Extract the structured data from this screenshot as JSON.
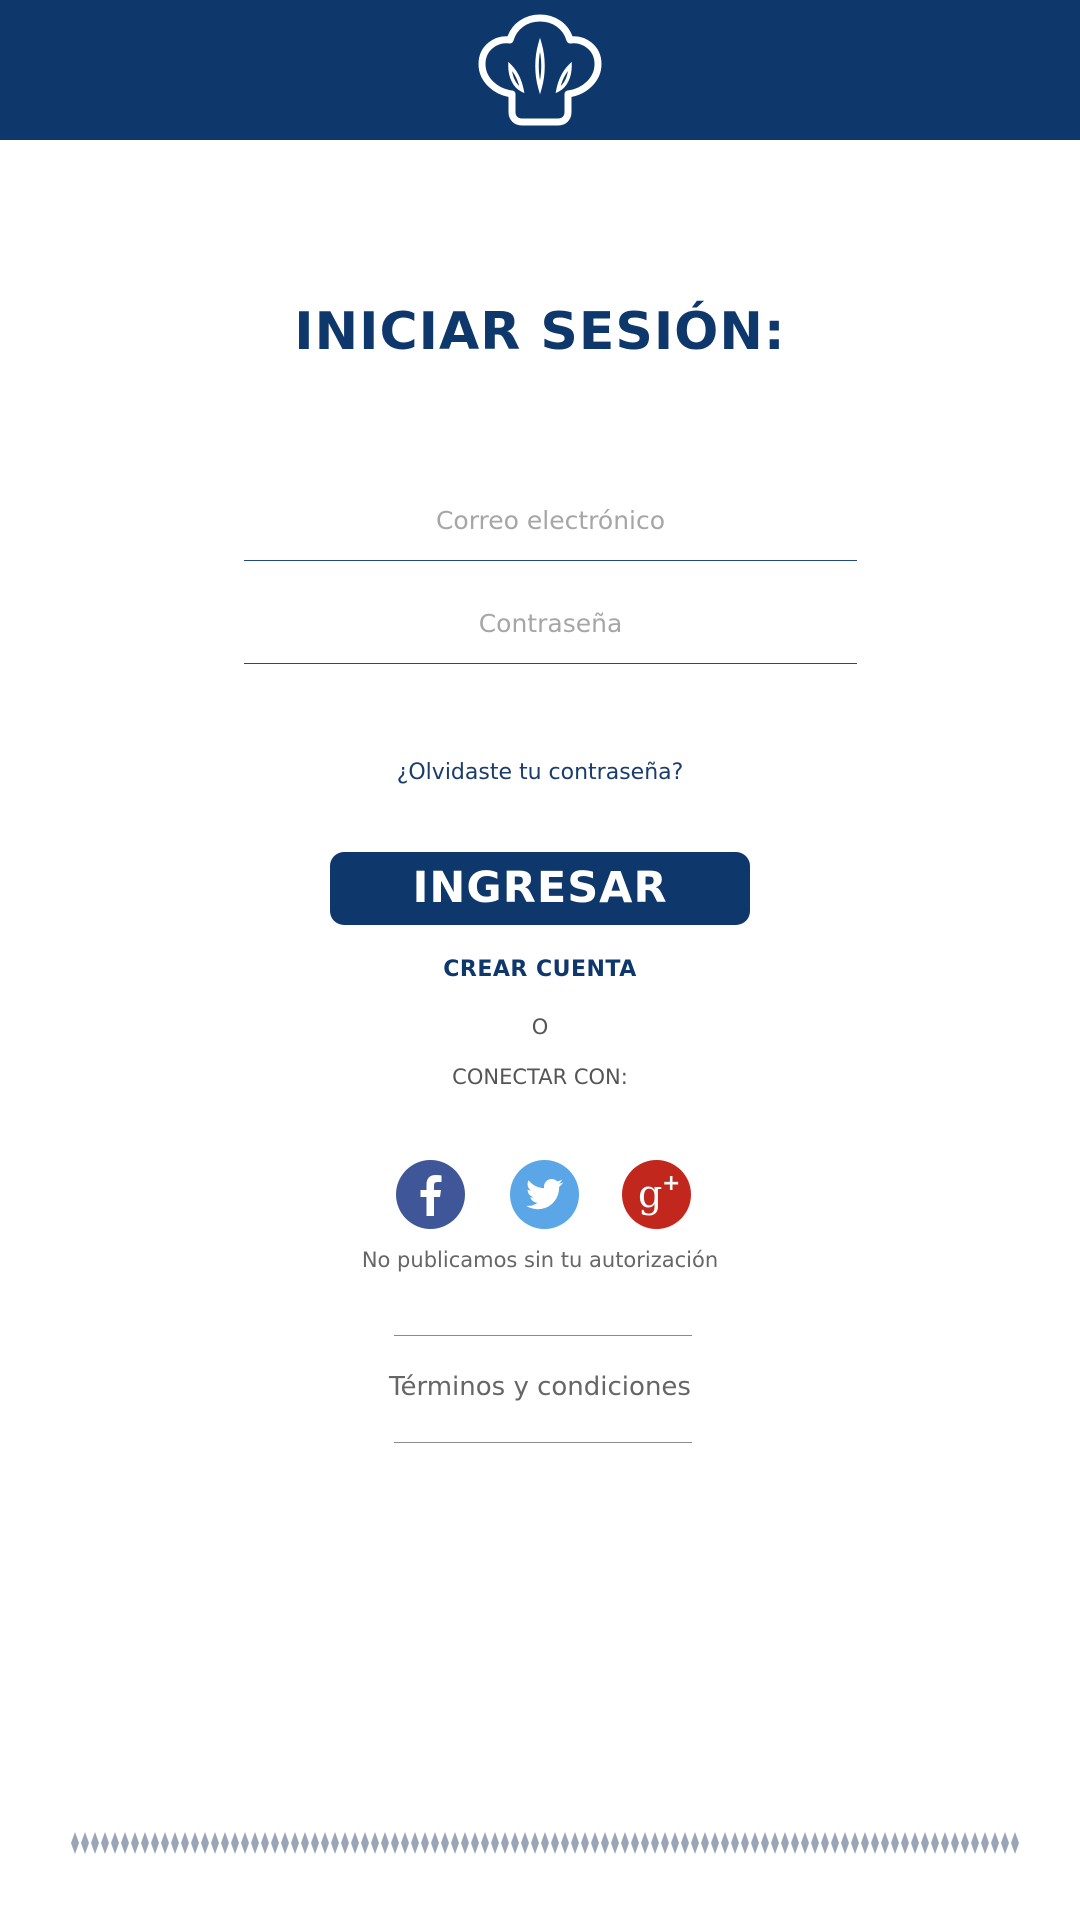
{
  "header": {
    "logo_icon": "chef-hat-icon",
    "background_color": "#0e376b"
  },
  "login": {
    "title": "INICIAR SESIÓN:",
    "email_placeholder": "Correo electrónico",
    "password_placeholder": "Contraseña",
    "forgot_link": "¿Olvidaste tu contraseña?",
    "submit_label": "INGRESAR",
    "create_account_label": "CREAR CUENTA"
  },
  "social": {
    "or_label": "O",
    "connect_label": "CONECTAR CON:",
    "buttons": [
      {
        "name": "facebook",
        "icon": "facebook-icon",
        "color": "#3f5798"
      },
      {
        "name": "twitter",
        "icon": "twitter-icon",
        "color": "#5aa6e6"
      },
      {
        "name": "google-plus",
        "icon": "google-plus-icon",
        "color": "#c1271d"
      }
    ],
    "privacy_note": "No publicamos sin tu autorización"
  },
  "footer": {
    "terms_label": "Términos y condiciones"
  }
}
